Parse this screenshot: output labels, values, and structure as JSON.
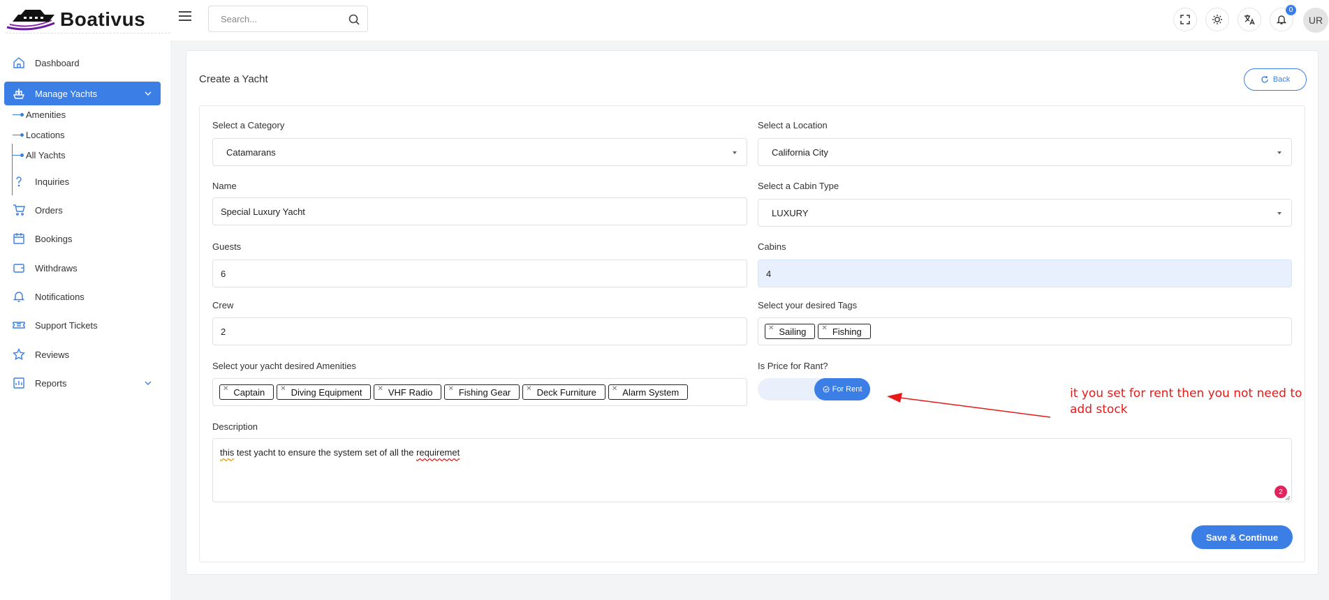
{
  "app": {
    "brand": "Boativus"
  },
  "header": {
    "search_placeholder": "Search...",
    "notifications_count": "0",
    "user_initials": "UR"
  },
  "sidebar": {
    "items": [
      {
        "label": "Dashboard",
        "icon": "home-icon"
      },
      {
        "label": "Manage Yachts",
        "icon": "ship-icon",
        "active": true,
        "expanded": true
      },
      {
        "label": "Inquiries",
        "icon": "question-icon"
      },
      {
        "label": "Orders",
        "icon": "cart-icon"
      },
      {
        "label": "Bookings",
        "icon": "calendar-icon"
      },
      {
        "label": "Withdraws",
        "icon": "wallet-icon"
      },
      {
        "label": "Notifications",
        "icon": "bell-icon"
      },
      {
        "label": "Support Tickets",
        "icon": "ticket-icon"
      },
      {
        "label": "Reviews",
        "icon": "star-icon"
      },
      {
        "label": "Reports",
        "icon": "report-icon"
      }
    ],
    "sub_items": [
      "Amenities",
      "Locations",
      "All Yachts"
    ]
  },
  "page": {
    "title": "Create a Yacht",
    "back_label": "Back",
    "save_label": "Save & Continue"
  },
  "form": {
    "category": {
      "label": "Select a Category",
      "value": "Catamarans"
    },
    "location": {
      "label": "Select a Location",
      "value": "California City"
    },
    "name": {
      "label": "Name",
      "value": "Special Luxury Yacht"
    },
    "cabin_type": {
      "label": "Select a Cabin Type",
      "value": "LUXURY"
    },
    "guests": {
      "label": "Guests",
      "value": "6"
    },
    "cabins": {
      "label": "Cabins",
      "value": "4"
    },
    "crew": {
      "label": "Crew",
      "value": "2"
    },
    "tags": {
      "label": "Select your desired Tags",
      "values": [
        "Sailing",
        "Fishing"
      ]
    },
    "amenities": {
      "label": "Select your yacht desired Amenities",
      "values": [
        "Captain",
        "Diving Equipment",
        "VHF Radio",
        "Fishing Gear",
        "Deck Furniture",
        "Alarm System"
      ]
    },
    "rent": {
      "label": "Is Price for Rant?",
      "toggle_label": "For Rent",
      "on": true
    },
    "description": {
      "label": "Description",
      "word1": "this",
      "middle": " test yacht to ensure the system set of all the ",
      "word2": "requiremet",
      "badge": "2"
    }
  },
  "annotation": {
    "text": "it you set for rent then you not need to add stock",
    "color": "#e61919"
  },
  "colors": {
    "accent": "#3a7ee6",
    "annotation": "#e61919"
  }
}
